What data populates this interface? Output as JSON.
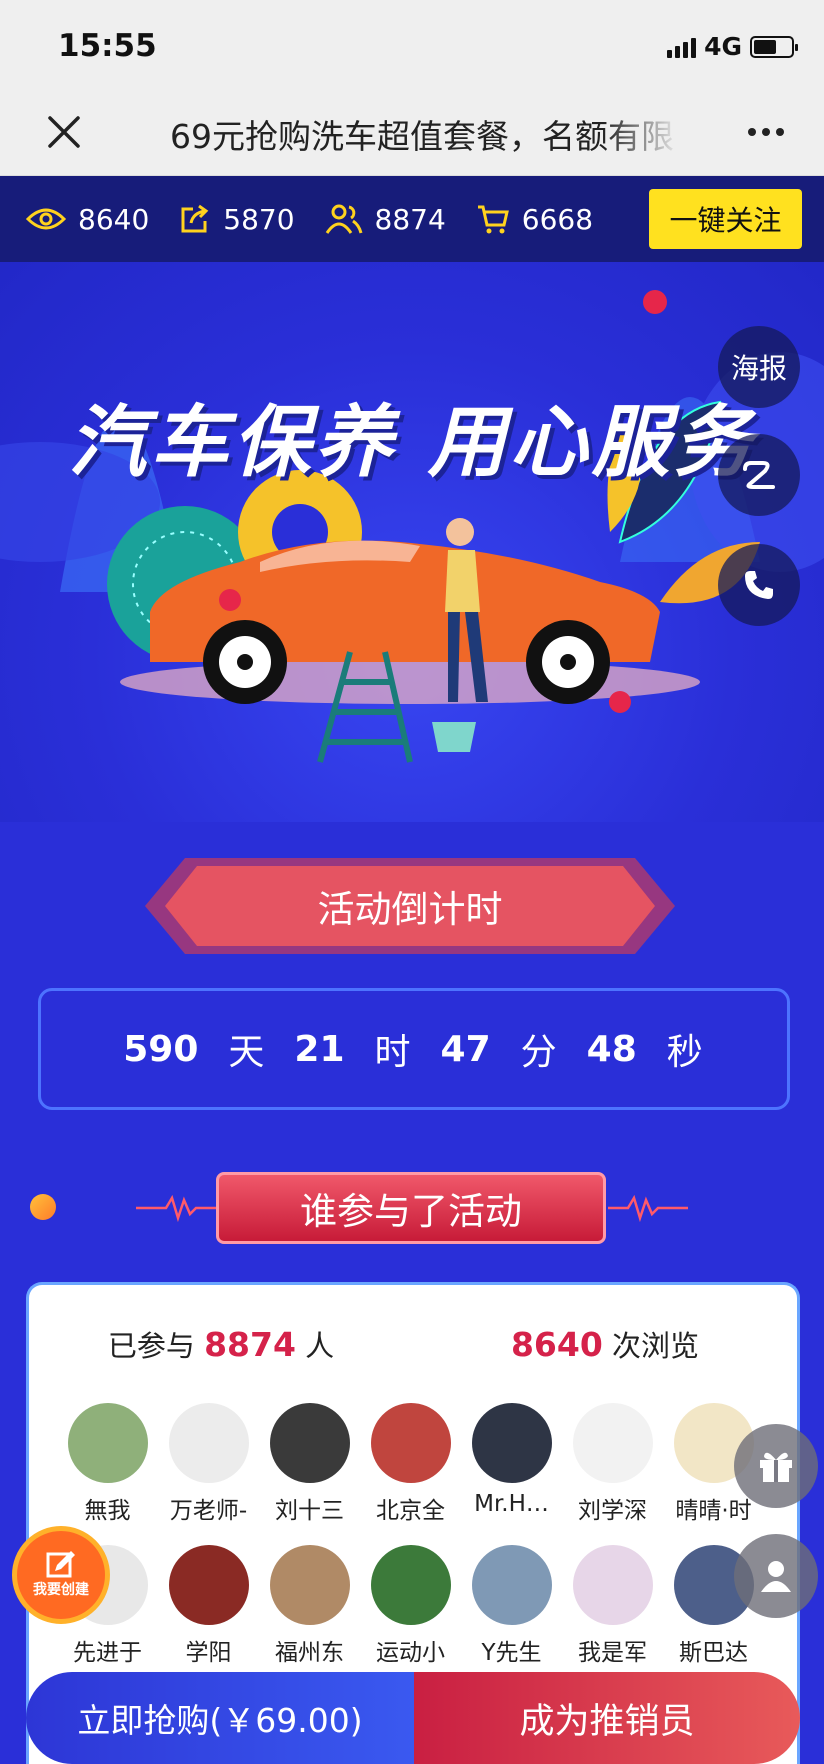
{
  "status_bar": {
    "time": "15:55",
    "network": "4G"
  },
  "nav": {
    "title": "69元抢购洗车超值套餐，名额有限"
  },
  "stats": [
    {
      "icon": "eye-icon",
      "value": "8640"
    },
    {
      "icon": "share-icon",
      "value": "5870"
    },
    {
      "icon": "people-icon",
      "value": "8874"
    },
    {
      "icon": "cart-icon",
      "value": "6668"
    }
  ],
  "follow_label": "一键关注",
  "hero": {
    "headline": "汽车保养 用心服务"
  },
  "side_buttons": {
    "poster": "海报"
  },
  "countdown": {
    "title": "活动倒计时",
    "days": "590",
    "days_unit": "天",
    "hours": "21",
    "hours_unit": "时",
    "minutes": "47",
    "minutes_unit": "分",
    "seconds": "48",
    "seconds_unit": "秒"
  },
  "participants": {
    "title": "谁参与了活动",
    "joined_prefix": "已参与",
    "joined_count": "8874",
    "joined_suffix": "人",
    "views_count": "8640",
    "views_suffix": "次浏览",
    "people": [
      {
        "name": "無我",
        "color": "#8fb07a"
      },
      {
        "name": "万老师-",
        "color": "#ececec"
      },
      {
        "name": "刘十三",
        "color": "#3a3a3a"
      },
      {
        "name": "北京全",
        "color": "#c0453e"
      },
      {
        "name": "Mr.H…",
        "color": "#2e3545"
      },
      {
        "name": "刘学深",
        "color": "#f2f2f2"
      },
      {
        "name": "晴晴·时",
        "color": "#f2e6c6"
      },
      {
        "name": "先进于",
        "color": "#e8e8e8"
      },
      {
        "name": "学阳",
        "color": "#8a2a24"
      },
      {
        "name": "福州东",
        "color": "#b08a66"
      },
      {
        "name": "运动小",
        "color": "#3c7a3a"
      },
      {
        "name": "Y先生",
        "color": "#7f99b5"
      },
      {
        "name": "我是军",
        "color": "#e7d6e8"
      },
      {
        "name": "斯巴达",
        "color": "#4d5f8a"
      }
    ]
  },
  "create_label": "我要创建",
  "bottom": {
    "buy_label": "立即抢购(￥69.00)",
    "promoter_label": "成为推销员"
  },
  "colors": {
    "accent_yellow": "#ffe11f",
    "hero_blue": "#2a2fd8",
    "highlight_red": "#d5224a"
  }
}
